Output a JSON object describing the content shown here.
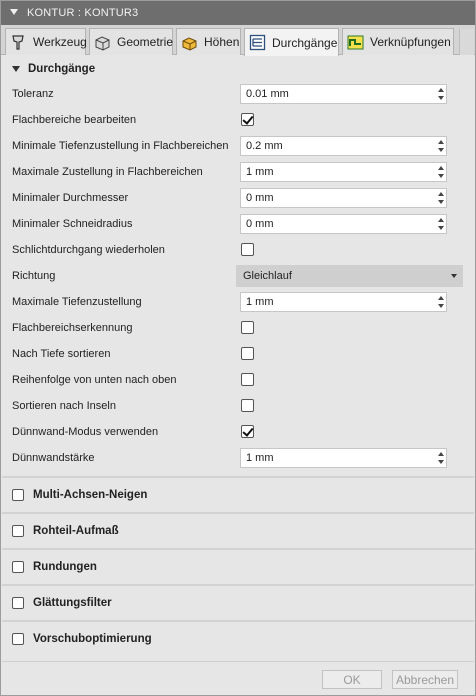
{
  "window": {
    "title": "KONTUR : KONTUR3"
  },
  "tabs": [
    {
      "label": "Werkzeug",
      "icon": "tool-icon"
    },
    {
      "label": "Geometrie",
      "icon": "geometry-icon"
    },
    {
      "label": "Höhen",
      "icon": "heights-icon"
    },
    {
      "label": "Durchgänge",
      "icon": "passes-icon",
      "active": true
    },
    {
      "label": "Verknüpfungen",
      "icon": "linking-icon"
    }
  ],
  "section": {
    "title": "Durchgänge"
  },
  "params": {
    "toleranz": {
      "label": "Toleranz",
      "value": "0.01 mm"
    },
    "flachbereiche": {
      "label": "Flachbereiche bearbeiten",
      "checked": true
    },
    "min_tiefenzustellung": {
      "label": "Minimale Tiefenzustellung in Flachbereichen",
      "value": "0.2 mm"
    },
    "max_zustellung": {
      "label": "Maximale Zustellung in Flachbereichen",
      "value": "1 mm"
    },
    "min_durchmesser": {
      "label": "Minimaler Durchmesser",
      "value": "0 mm"
    },
    "min_schneidradius": {
      "label": "Minimaler Schneidradius",
      "value": "0 mm"
    },
    "schlichtdurchgang": {
      "label": "Schlichtdurchgang wiederholen",
      "checked": false
    },
    "richtung": {
      "label": "Richtung",
      "value": "Gleichlauf"
    },
    "max_tiefenzustellung": {
      "label": "Maximale Tiefenzustellung",
      "value": "1 mm"
    },
    "flachbereichserkennung": {
      "label": "Flachbereichserkennung",
      "checked": false
    },
    "nach_tiefe": {
      "label": "Nach Tiefe sortieren",
      "checked": false
    },
    "reihenfolge": {
      "label": "Reihenfolge von unten nach oben",
      "checked": false
    },
    "inseln": {
      "label": "Sortieren nach Inseln",
      "checked": false
    },
    "duennwand_modus": {
      "label": "Dünnwand-Modus verwenden",
      "checked": true
    },
    "duennwandstaerke": {
      "label": "Dünnwandstärke",
      "value": "1 mm"
    }
  },
  "groups": [
    {
      "label": "Multi-Achsen-Neigen",
      "checked": false
    },
    {
      "label": "Rohteil-Aufmaß",
      "checked": false
    },
    {
      "label": "Rundungen",
      "checked": false
    },
    {
      "label": "Glättungsfilter",
      "checked": false
    },
    {
      "label": "Vorschuboptimierung",
      "checked": false
    }
  ],
  "footer": {
    "ok_label": "OK",
    "cancel_label": "Abbrechen"
  }
}
